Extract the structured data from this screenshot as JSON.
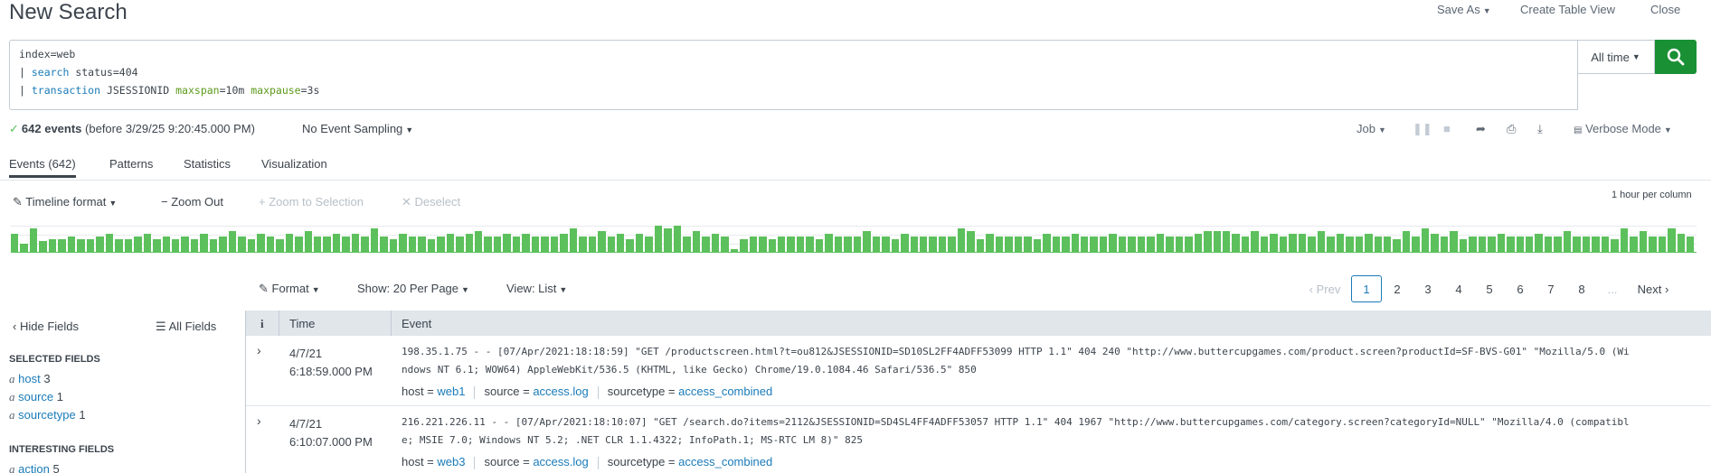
{
  "header": {
    "title": "New Search",
    "save_as": "Save As",
    "create_table_view": "Create Table View",
    "close": "Close"
  },
  "search": {
    "line1": "index=web",
    "line2_pipe": "| ",
    "line2_cmd": "search",
    "line2_rest": " status=404",
    "line3_pipe": "| ",
    "line3_cmd": "transaction",
    "line3_field": " JSESSIONID ",
    "line3_arg1": "maxspan",
    "line3_val1": "=10m ",
    "line3_arg2": "maxpause",
    "line3_val2": "=3s",
    "time_range": "All time"
  },
  "status": {
    "events_count": "642 events",
    "before": "(before 3/29/25 9:20:45.000 PM)",
    "sampling": "No Event Sampling",
    "job": "Job",
    "mode": "Verbose Mode"
  },
  "tabs": [
    "Events (642)",
    "Patterns",
    "Statistics",
    "Visualization"
  ],
  "timeline": {
    "format": "Timeline format",
    "zoom_out": "Zoom Out",
    "zoom_selection": "Zoom to Selection",
    "deselect": "Deselect",
    "scale": "1 hour per column",
    "bars": [
      0.7,
      0.3,
      0.9,
      0.4,
      0.5,
      0.5,
      0.6,
      0.5,
      0.5,
      0.6,
      0.7,
      0.5,
      0.5,
      0.6,
      0.7,
      0.5,
      0.6,
      0.5,
      0.6,
      0.5,
      0.7,
      0.5,
      0.6,
      0.8,
      0.6,
      0.5,
      0.7,
      0.6,
      0.5,
      0.7,
      0.6,
      0.8,
      0.6,
      0.6,
      0.7,
      0.6,
      0.7,
      0.6,
      0.9,
      0.6,
      0.5,
      0.7,
      0.6,
      0.6,
      0.5,
      0.6,
      0.7,
      0.6,
      0.7,
      0.8,
      0.6,
      0.6,
      0.7,
      0.6,
      0.7,
      0.6,
      0.6,
      0.6,
      0.7,
      0.9,
      0.6,
      0.6,
      0.8,
      0.6,
      0.7,
      0.5,
      0.7,
      0.6,
      1.0,
      0.9,
      1.0,
      0.6,
      0.8,
      0.6,
      0.7,
      0.6,
      0.1,
      0.5,
      0.6,
      0.6,
      0.5,
      0.6,
      0.6,
      0.6,
      0.6,
      0.5,
      0.7,
      0.6,
      0.6,
      0.6,
      0.8,
      0.6,
      0.6,
      0.5,
      0.7,
      0.6,
      0.6,
      0.6,
      0.6,
      0.6,
      0.9,
      0.8,
      0.5,
      0.7,
      0.6,
      0.6,
      0.6,
      0.6,
      0.5,
      0.7,
      0.6,
      0.6,
      0.7,
      0.6,
      0.6,
      0.6,
      0.7,
      0.6,
      0.6,
      0.6,
      0.6,
      0.7,
      0.6,
      0.6,
      0.6,
      0.7,
      0.8,
      0.8,
      0.8,
      0.7,
      0.6,
      0.8,
      0.6,
      0.7,
      0.6,
      0.7,
      0.7,
      0.6,
      0.8,
      0.6,
      0.7,
      0.6,
      0.6,
      0.7,
      0.6,
      0.6,
      0.5,
      0.8,
      0.6,
      0.9,
      0.7,
      0.6,
      0.8,
      0.5,
      0.6,
      0.6,
      0.6,
      0.7,
      0.6,
      0.6,
      0.6,
      0.7,
      0.6,
      0.6,
      0.8,
      0.6,
      0.6,
      0.6,
      0.6,
      0.5,
      0.9,
      0.6,
      0.8,
      0.6,
      0.6,
      0.9,
      0.7,
      0.6
    ],
    "highlight": [
      0.05,
      0.1
    ]
  },
  "toolbar": {
    "format": "Format",
    "show": "Show: 20 Per Page",
    "view": "View: List"
  },
  "pager": {
    "prev": "‹ Prev",
    "pages": [
      "1",
      "2",
      "3",
      "4",
      "5",
      "6",
      "7",
      "8",
      "..."
    ],
    "next": "Next ›"
  },
  "sidebar": {
    "hide_fields": "Hide Fields",
    "all_fields": "All Fields",
    "selected_heading": "SELECTED FIELDS",
    "selected": [
      {
        "name": "host",
        "count": "3"
      },
      {
        "name": "source",
        "count": "1"
      },
      {
        "name": "sourcetype",
        "count": "1"
      }
    ],
    "interesting_heading": "INTERESTING FIELDS",
    "interesting": [
      {
        "name": "action",
        "count": "5"
      }
    ]
  },
  "table": {
    "col_info": "i",
    "col_time": "Time",
    "col_event": "Event",
    "rows": [
      {
        "date": "4/7/21",
        "time": "6:18:59.000 PM",
        "line1": "198.35.1.75 - - [07/Apr/2021:18:18:59] \"GET /productscreen.html?t=ou812&JSESSIONID=SD10SL2FF4ADFF53099 HTTP 1.1\" 404 240 \"http://www.buttercupgames.com/product.screen?productId=SF-BVS-G01\" \"Mozilla/5.0 (Wi",
        "line2": "ndows NT 6.1; WOW64) AppleWebKit/536.5 (KHTML, like Gecko) Chrome/19.0.1084.46 Safari/536.5\" 850",
        "host": "web1",
        "source": "access.log",
        "sourcetype": "access_combined"
      },
      {
        "date": "4/7/21",
        "time": "6:10:07.000 PM",
        "line1": "216.221.226.11 - - [07/Apr/2021:18:10:07] \"GET /search.do?items=2112&JSESSIONID=SD4SL4FF4ADFF53057 HTTP 1.1\" 404 1967 \"http://www.buttercupgames.com/category.screen?categoryId=NULL\" \"Mozilla/4.0 (compatibl",
        "line2": "e; MSIE 7.0; Windows NT 5.2; .NET CLR 1.1.4322; InfoPath.1; MS-RTC LM 8)\" 825",
        "host": "web3",
        "source": "access.log",
        "sourcetype": "access_combined"
      }
    ],
    "host_label": "host = ",
    "source_label": "source = ",
    "sourcetype_label": "sourcetype = "
  }
}
